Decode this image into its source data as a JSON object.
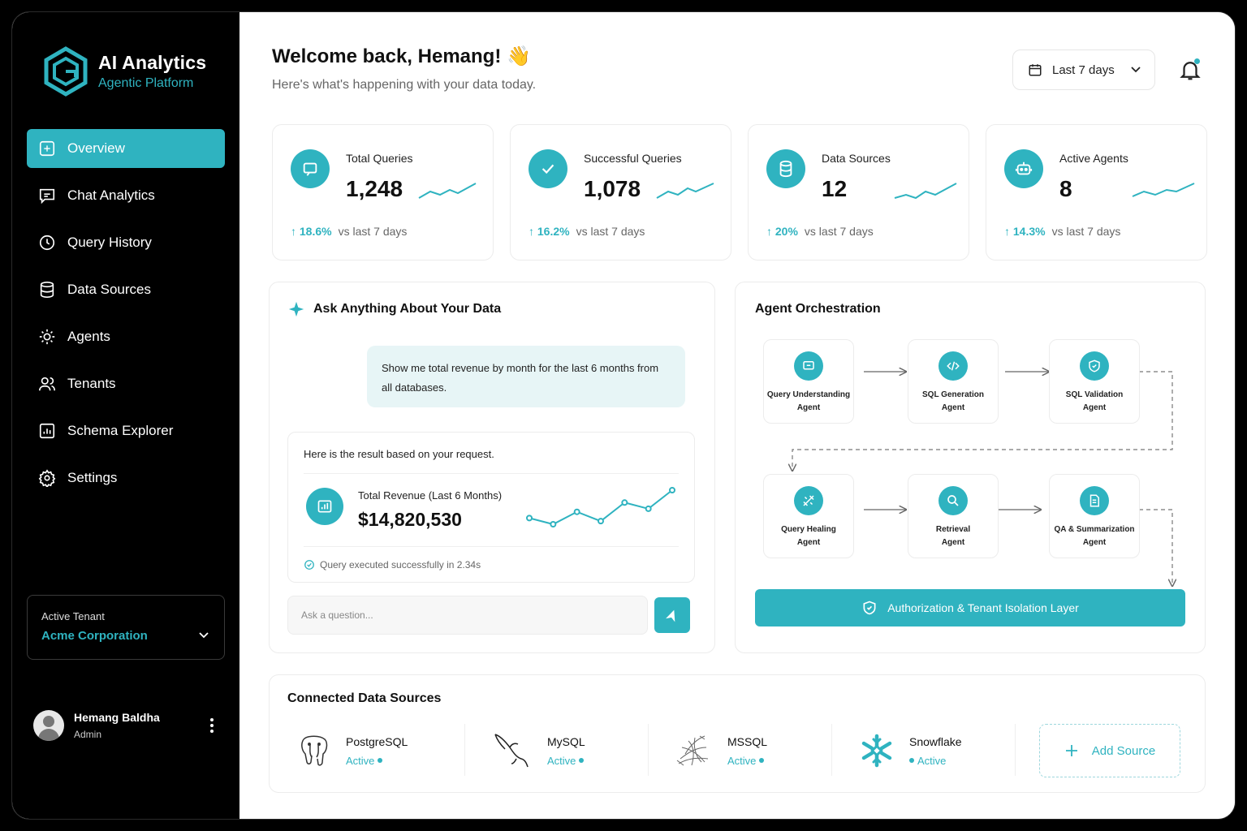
{
  "brand": {
    "title": "AI Analytics",
    "subtitle": "Agentic Platform"
  },
  "nav": [
    {
      "label": "Overview",
      "icon": "overview-icon",
      "active": true
    },
    {
      "label": "Chat Analytics",
      "icon": "chat-icon"
    },
    {
      "label": "Query History",
      "icon": "clock-icon"
    },
    {
      "label": "Data Sources",
      "icon": "database-icon"
    },
    {
      "label": "Agents",
      "icon": "agent-icon"
    },
    {
      "label": "Tenants",
      "icon": "users-icon"
    },
    {
      "label": "Schema Explorer",
      "icon": "schema-icon"
    },
    {
      "label": "Settings",
      "icon": "gear-icon"
    }
  ],
  "tenant": {
    "label": "Active Tenant",
    "value": "Acme Corporation"
  },
  "user": {
    "name": "Hemang Baldha",
    "role": "Admin"
  },
  "header": {
    "greeting": "Welcome back, Hemang! 👋",
    "subtitle": "Here's what's happening with your data today.",
    "date_range": "Last 7 days"
  },
  "stats": [
    {
      "label": "Total Queries",
      "value": "1,248",
      "change": "18.6%",
      "compare": "vs last 7 days",
      "icon": "chat-icon"
    },
    {
      "label": "Successful Queries",
      "value": "1,078",
      "change": "16.2%",
      "compare": "vs last 7 days",
      "icon": "check-icon"
    },
    {
      "label": "Data Sources",
      "value": "12",
      "change": "20%",
      "compare": "vs last 7 days",
      "icon": "database-icon"
    },
    {
      "label": "Active Agents",
      "value": "8",
      "change": "14.3%",
      "compare": "vs last 7 days",
      "icon": "robot-icon"
    }
  ],
  "ask": {
    "title": "Ask Anything About Your Data",
    "user_message": "Show me total revenue by month for the last 6 months from all databases.",
    "result_intro": "Here is the result based on your request.",
    "metric_label": "Total Revenue (Last 6 Months)",
    "metric_value": "$14,820,530",
    "status": "Query executed successfully in 2.34s",
    "input_placeholder": "Ask a question...",
    "trend": [
      3,
      1,
      5,
      2,
      8,
      6,
      12
    ]
  },
  "orchestration": {
    "title": "Agent Orchestration",
    "agents": [
      {
        "name": "Query Understanding\nAgent",
        "icon": "message-icon"
      },
      {
        "name": "SQL Generation\nAgent",
        "icon": "code-icon"
      },
      {
        "name": "SQL Validation\nAgent",
        "icon": "shield-check-icon"
      },
      {
        "name": "Query Healing\nAgent",
        "icon": "tools-icon"
      },
      {
        "name": "Retrieval\nAgent",
        "icon": "search-icon"
      },
      {
        "name": "QA & Summarization\nAgent",
        "icon": "document-icon"
      }
    ],
    "auth_layer": "Authorization & Tenant Isolation Layer"
  },
  "sources": {
    "title": "Connected Data Sources",
    "items": [
      {
        "name": "PostgreSQL",
        "status": "Active",
        "icon": "postgresql-icon"
      },
      {
        "name": "MySQL",
        "status": "Active",
        "icon": "mysql-icon"
      },
      {
        "name": "MSSQL",
        "status": "Active",
        "icon": "mssql-icon"
      },
      {
        "name": "Snowflake",
        "status": "Active",
        "icon": "snowflake-icon"
      }
    ],
    "add_label": "Add Source"
  },
  "colors": {
    "accent": "#2fb3c0",
    "sidebar": "#000000"
  }
}
